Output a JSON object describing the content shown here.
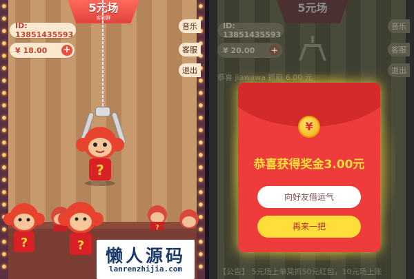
{
  "game": {
    "title_big": "5元场",
    "title_small": "实时群",
    "user_id": "ID: 13851435593",
    "balance": "¥ 18.00",
    "plus_label": "+",
    "music_label": "音乐",
    "service_label": "客服",
    "exit_label": "退出"
  },
  "watermark": {
    "cn": "懒人源码",
    "en": "lanrenzhijia.com"
  },
  "overlay_bg": {
    "title_big": "5元场",
    "user_id": "ID: 13851435593",
    "balance": "¥ 20.00",
    "plus_label": "+",
    "music_label": "音乐",
    "service_label": "客服",
    "exit_label": "退出",
    "ticker": "恭喜 jiawawa 抓取 6.00 元",
    "notice": "【公告】 5元场上单局抓50元红包，10元场上账"
  },
  "redpacket": {
    "coin_symbol": "¥",
    "message": "恭喜获得奖金3.00元",
    "share_button": "向好友借运气",
    "again_button": "再来一把"
  },
  "colors": {
    "accent_red": "#ee3b3b",
    "gold": "#ffde3a",
    "stripe_light": "#c79a6d",
    "stripe_dark": "#b4845a"
  }
}
